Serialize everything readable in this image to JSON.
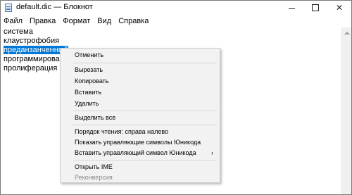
{
  "window": {
    "title": "default.dic — Блокнот",
    "controls": {
      "minimize_icon": "minimize-icon",
      "maximize_icon": "maximize-icon",
      "close_glyph": "✕"
    }
  },
  "menubar": [
    "Файл",
    "Правка",
    "Формат",
    "Вид",
    "Справка"
  ],
  "editor": {
    "lines": [
      "система",
      "клаустрофобия",
      "преданзанченный",
      "программирован",
      "пролиферация"
    ],
    "selected_line": 2
  },
  "context_menu": {
    "undo": "Отменить",
    "cut": "Вырезать",
    "copy": "Копировать",
    "paste": "Вставить",
    "delete": "Удалить",
    "select_all": "Выделить все",
    "rtl": "Порядок чтения: справа налево",
    "show_unicode": "Показать управляющие символы Юникода",
    "insert_unicode": "Вставить управляющий символ Юникода",
    "submenu_arrow": "›",
    "open_ime": "Открыть IME",
    "reconversion": "Реконверсия"
  },
  "colors": {
    "selection": "#0078d7",
    "menu_bg": "#f2f2f2",
    "disabled_text": "#8a8a8a"
  }
}
